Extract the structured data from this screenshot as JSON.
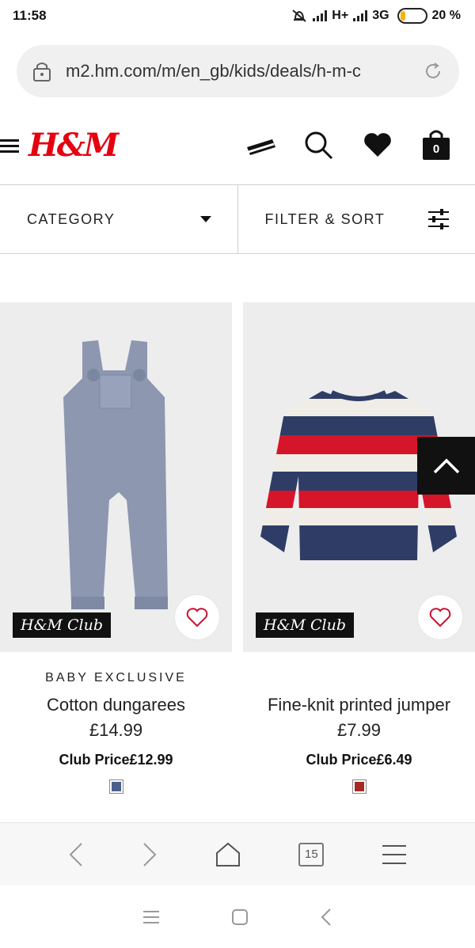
{
  "status_bar": {
    "time": "11:58",
    "network_a": "H+",
    "network_b": "3G",
    "battery": "20 %",
    "battery_level": 0.2
  },
  "browser": {
    "url": "m2.hm.com/m/en_gb/kids/deals/h-m-c",
    "tab_count": "15"
  },
  "header": {
    "logo": "H&M",
    "cart_count": "0"
  },
  "filters": {
    "category_label": "CATEGORY",
    "filter_sort_label": "FILTER & SORT"
  },
  "products": [
    {
      "tag": "BABY EXCLUSIVE",
      "name": "Cotton dungarees",
      "price": "£14.99",
      "club_price": "Club Price£12.99",
      "badge": "H&M Club",
      "swatch_color": "#4a5f8c"
    },
    {
      "tag": "",
      "name": "Fine-knit printed jumper",
      "price": "£7.99",
      "club_price": "Club Price£6.49",
      "badge": "H&M Club",
      "swatch_color": "#a42a24"
    }
  ],
  "colors": {
    "brand_red": "#e50010",
    "text": "#222222"
  }
}
